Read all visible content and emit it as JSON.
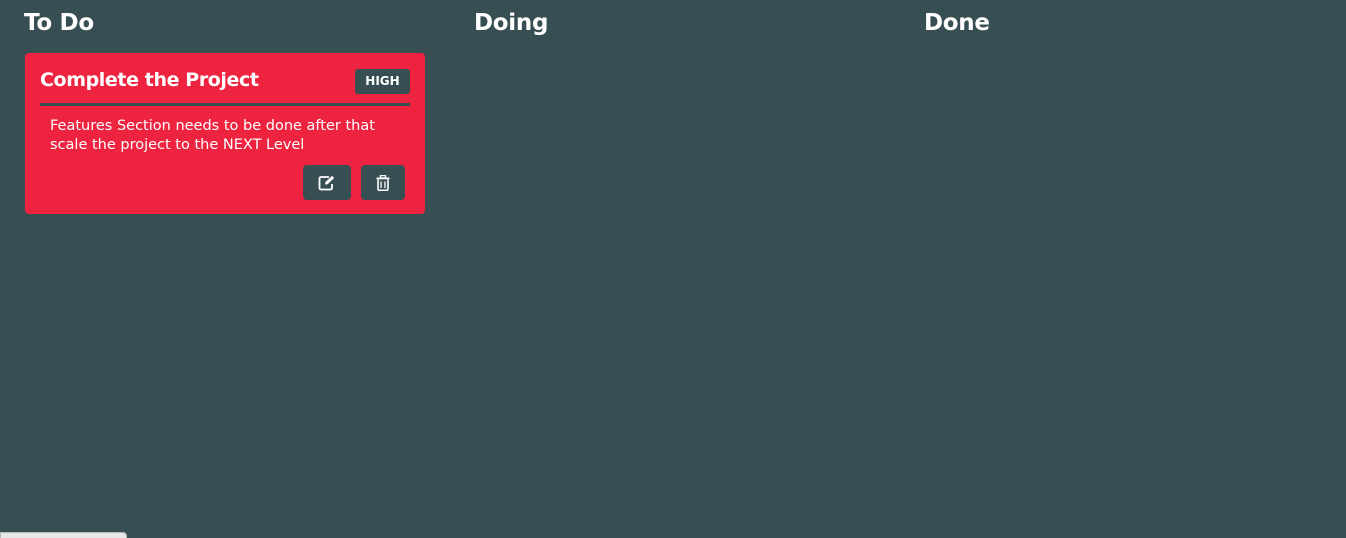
{
  "columns": [
    {
      "title": "To Do",
      "cards": [
        {
          "title": "Complete the Project",
          "priority": "HIGH",
          "description": "Features Section needs to be done after that scale the project to the NEXT Level",
          "actions": [
            {
              "icon": "edit-icon"
            },
            {
              "icon": "trash-icon"
            }
          ]
        }
      ]
    },
    {
      "title": "Doing",
      "cards": []
    },
    {
      "title": "Done",
      "cards": []
    }
  ],
  "colors": {
    "background": "#374f52",
    "card_high_priority": "#ee2340",
    "text": "#ffffff"
  }
}
